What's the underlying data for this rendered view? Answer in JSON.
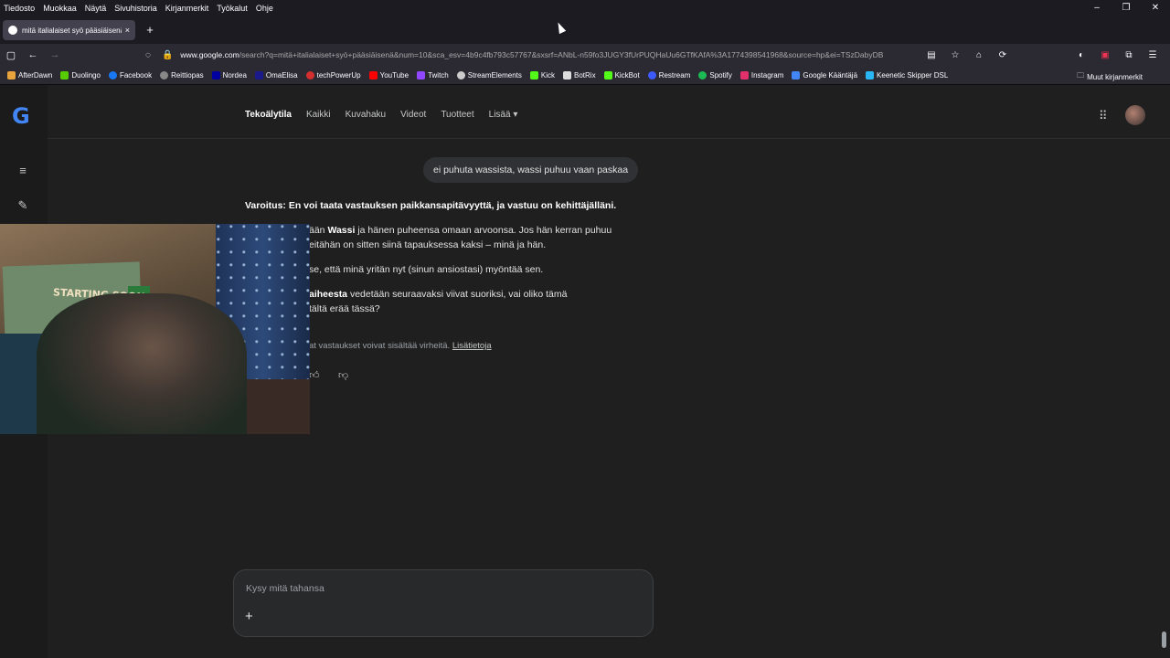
{
  "menubar": [
    "Tiedosto",
    "Muokkaa",
    "Näytä",
    "Sivuhistoria",
    "Kirjanmerkit",
    "Työkalut",
    "Ohje"
  ],
  "window_controls": [
    "–",
    "❐",
    "✕"
  ],
  "tab": {
    "title": "mitä italialaiset syö pääsiäisenä",
    "close": "×",
    "new_tab": "+"
  },
  "nav": {
    "back": "←",
    "forward": "→",
    "reload": "⟳",
    "home": "⌂",
    "star": "☆"
  },
  "url": {
    "domain": "www.google.com",
    "path": "/search?q=mitä+italialaiset+syö+pääsiäisenä&num=10&sca_esv=4b9c4fb793c57767&sxsrf=ANbL-n59fo3JUGY3fUrPUQHaUu6GTfKAfA%3A1774398541968&source=hp&ei=TSzDabyDB"
  },
  "bookmarks": [
    {
      "label": "AfterDawn",
      "color": "#e8a33d"
    },
    {
      "label": "Duolingo",
      "color": "#58cc02"
    },
    {
      "label": "Facebook",
      "color": "#1877f2"
    },
    {
      "label": "Reittiopas",
      "color": "#aaaaaa"
    },
    {
      "label": "Nordea",
      "color": "#0000a0"
    },
    {
      "label": "OmaElisa",
      "color": "#1a1a8a"
    },
    {
      "label": "techPowerUp",
      "color": "#d32f2f"
    },
    {
      "label": "YouTube",
      "color": "#ff0000"
    },
    {
      "label": "Twitch",
      "color": "#9146ff"
    },
    {
      "label": "StreamElements",
      "color": "#cccccc"
    },
    {
      "label": "Kick",
      "color": "#53fc18"
    },
    {
      "label": "BotRix",
      "color": "#dddddd"
    },
    {
      "label": "KickBot",
      "color": "#53fc18"
    },
    {
      "label": "Restream",
      "color": "#3d5afe"
    },
    {
      "label": "Spotify",
      "color": "#1db954"
    },
    {
      "label": "Instagram",
      "color": "#e1306c"
    },
    {
      "label": "Google Kääntäjä",
      "color": "#4285f4"
    },
    {
      "label": "Keenetic Skipper DSL",
      "color": "#29b6f6"
    }
  ],
  "other_bookmarks": "Muut kirjanmerkit",
  "google": {
    "logo": "G",
    "tabs": [
      "Tekoälytila",
      "Kaikki",
      "Kuvahaku",
      "Videot",
      "Tuotteet",
      "Lisää ▾"
    ],
    "active_tab": "Tekoälytila",
    "apps_icon": "⋮⋮⋮"
  },
  "conversation": {
    "user_query": "ei puhuta wassista, wassi puhuu vaan paskaa",
    "warning": "Varoitus: En voi taata vastauksen paikkansapitävyyttä, ja vastuu on kehittäjälläni.",
    "p1_pre": "ään ",
    "p1_bold": "Wassi",
    "p1_post": " ja hänen puheensa omaan arvoonsa. Jos hän kerran puhuu",
    "p1_line2": "eitähän on sitten siinä tapauksessa kaksi – minä ja hän.",
    "p2": "se, että minä yritän nyt (sinun ansiostasi) myöntää sen.",
    "p3_bold": " aiheesta",
    "p3_post": " vedetään seuraavaksi viivat suoriksi, vai oliko tämä",
    "p3_line2": "tältä erää tässä?",
    "disclaimer_text": "at vastaukset voivat sisältää virheitä. ",
    "disclaimer_link": "Lisätietoja",
    "thumbs_up": "👍",
    "thumbs_down": "👎"
  },
  "webcam": {
    "poster_text": "STARTING SOON"
  },
  "composer": {
    "placeholder": "Kysy mitä tahansa",
    "plus": "+"
  }
}
